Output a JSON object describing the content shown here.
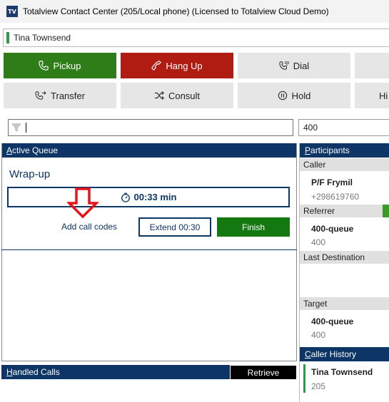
{
  "window": {
    "icon_text": "TV",
    "title": "Totalview Contact Center (205/Local phone) (Licensed to Totalview Cloud Demo)"
  },
  "user": {
    "name": "Tina Townsend",
    "status_color": "#2a9a4c"
  },
  "toolbar": {
    "pickup": "Pickup",
    "hangup": "Hang Up",
    "dial": "Dial",
    "transfer": "Transfer",
    "consult": "Consult",
    "hold": "Hold",
    "cut_label": "Hi"
  },
  "filter": {
    "value": "",
    "number_value": "400"
  },
  "active_queue": {
    "header_accel": "A",
    "header_rest": "ctive Queue",
    "wrapup_title": "Wrap-up",
    "timer": "00:33 min",
    "add_call_codes": "Add call codes",
    "extend": "Extend 00:30",
    "finish": "Finish"
  },
  "handled_calls": {
    "header_accel": "H",
    "header_rest": "andled Calls",
    "retrieve": "Retrieve"
  },
  "participants": {
    "header_accel": "P",
    "header_rest": "articipants",
    "caller_label": "Caller",
    "caller_name": "P/F Frymil",
    "caller_number": "+298619760",
    "referrer_label": "Referrer",
    "referrer_name": "400-queue",
    "referrer_number": "400",
    "last_destination_label": "Last Destination",
    "target_label": "Target",
    "target_name": "400-queue",
    "target_number": "400"
  },
  "caller_history": {
    "header_accel": "C",
    "header_rest": "aller History",
    "entry_name": "Tina Townsend",
    "entry_number": "205"
  },
  "colors": {
    "navy": "#0d3566",
    "pickup_green": "#2e7d18",
    "hangup_red": "#b01b12",
    "finish_green": "#13780f",
    "annotation_red": "#e8141b"
  }
}
